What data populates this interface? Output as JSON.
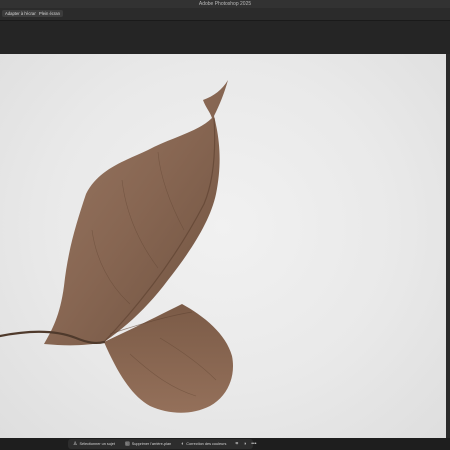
{
  "window": {
    "title": "Adobe Photoshop 2025"
  },
  "options_bar": {
    "buttons": [
      {
        "label": "Adapter à l'écran"
      },
      {
        "label": "Plein écran"
      }
    ]
  },
  "contextual_taskbar": {
    "buttons": [
      {
        "label": "Sélectionner un sujet",
        "icon": "person-icon"
      },
      {
        "label": "Supprimer l'arrière-plan",
        "icon": "remove-background-icon"
      },
      {
        "label": "Correction des couleurs",
        "icon": "color-adjust-icon"
      }
    ],
    "extra_icons": [
      "crop-icon",
      "mask-circle-icon",
      "more-icon"
    ]
  },
  "colors": {
    "ui_dark": "#1e1e1e",
    "canvas_background": "#ececec",
    "leaf_brown": "#8a6a55"
  }
}
